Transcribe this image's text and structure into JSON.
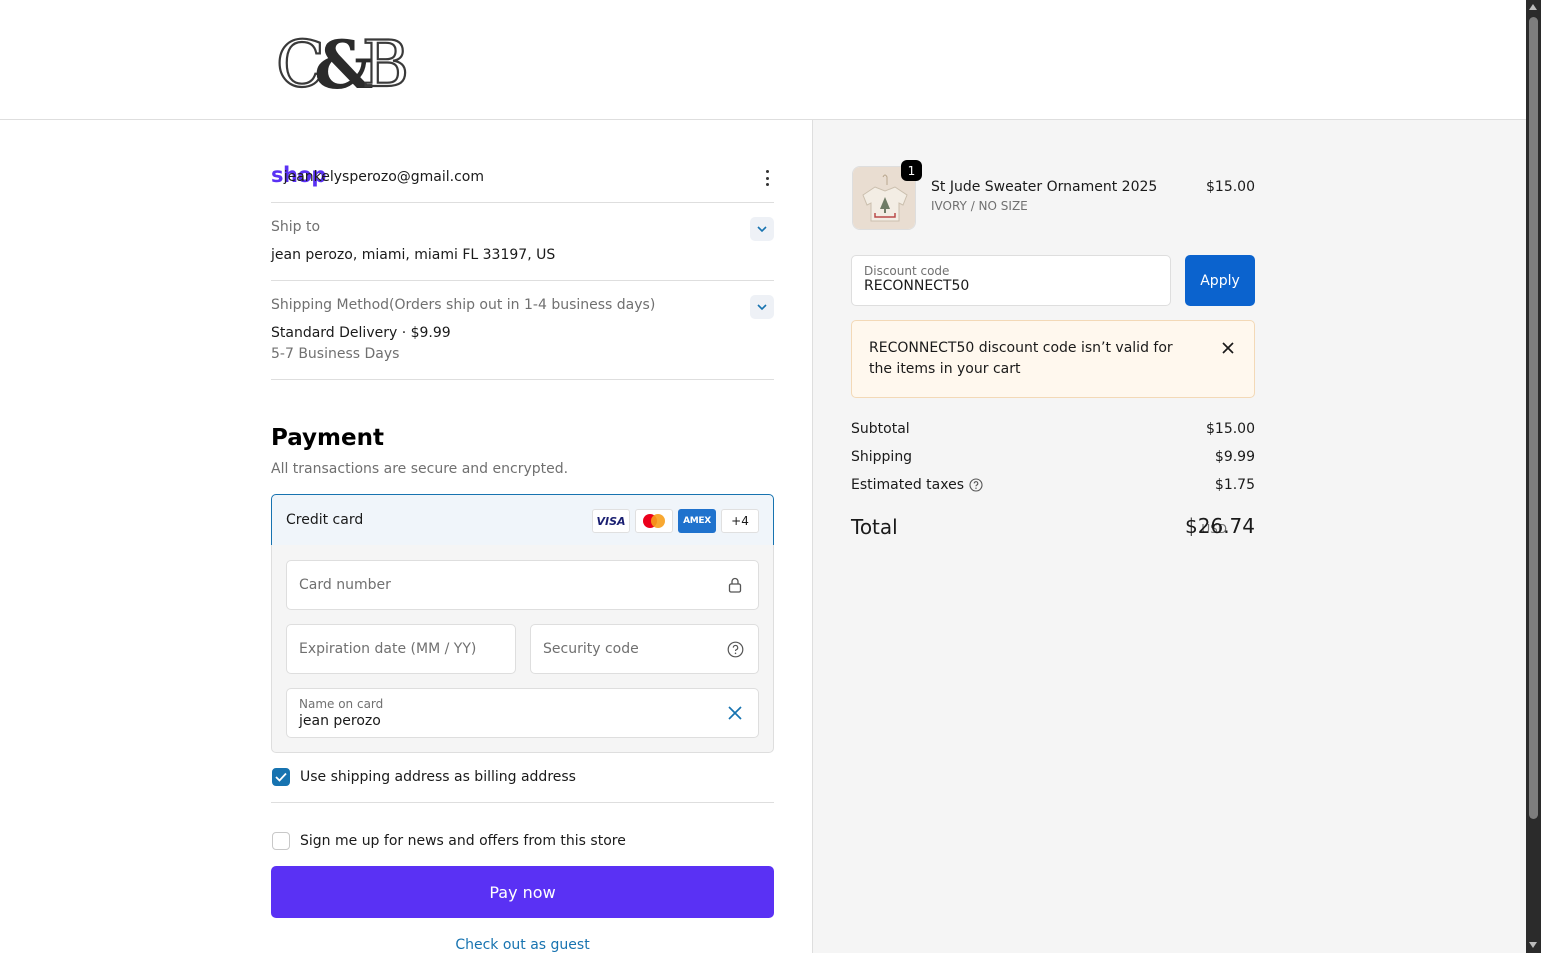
{
  "header": {
    "logo_text": "C&B"
  },
  "contact": {
    "shop_label": "shop",
    "email": "jeankelysperozo@gmail.com"
  },
  "ship_to": {
    "label": "Ship to",
    "value": "jean perozo, miami, miami FL 33197, US"
  },
  "shipping_method": {
    "label": "Shipping Method(Orders ship out in 1-4 business days)",
    "value": "Standard Delivery · $9.99",
    "sub": "5-7 Business Days"
  },
  "payment": {
    "title": "Payment",
    "subtitle": "All transactions are secure and encrypted.",
    "method_label": "Credit card",
    "badges": {
      "visa": "VISA",
      "amex": "AMEX",
      "more": "+4"
    },
    "card_number_placeholder": "Card number",
    "expiry_placeholder": "Expiration date (MM / YY)",
    "security_placeholder": "Security code",
    "name_label": "Name on card",
    "name_value": "jean perozo",
    "billing_checkbox_label": "Use shipping address as billing address",
    "billing_checked": true,
    "news_checkbox_label": "Sign me up for news and offers from this store",
    "news_checked": false,
    "pay_button": "Pay now",
    "guest_link": "Check out as guest"
  },
  "cart": {
    "item": {
      "quantity": "1",
      "name": "St Jude Sweater Ornament 2025",
      "variant": "IVORY / NO SIZE",
      "price": "$15.00"
    },
    "discount": {
      "label": "Discount code",
      "value": "RECONNECT50",
      "apply_button": "Apply",
      "error": "RECONNECT50 discount code isn’t valid for the items in your cart"
    },
    "summary": {
      "subtotal_label": "Subtotal",
      "subtotal_value": "$15.00",
      "shipping_label": "Shipping",
      "shipping_value": "$9.99",
      "taxes_label": "Estimated taxes",
      "taxes_value": "$1.75",
      "total_label": "Total",
      "total_currency": "USD",
      "total_value": "$26.74"
    }
  },
  "colors": {
    "shop_purple": "#5a31f4",
    "accent_blue": "#1773b0",
    "apply_blue": "#0b63ce",
    "alert_bg": "#fff8ee"
  }
}
